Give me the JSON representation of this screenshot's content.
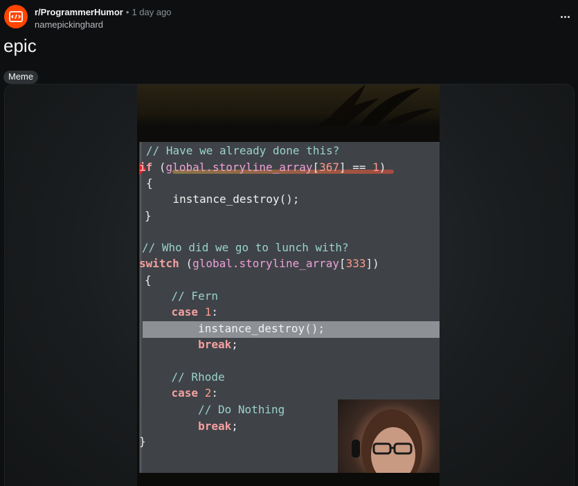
{
  "post": {
    "subreddit": "r/ProgrammerHumor",
    "separator": "•",
    "time": "1 day ago",
    "author": "namepickinghard",
    "title": "epic",
    "flair": "Meme"
  },
  "icons": {
    "subreddit_avatar": "subreddit-logo-icon",
    "more": "more-options-icon"
  },
  "colors": {
    "background": "#0e0f11",
    "avatar": "#ff4500",
    "flair_bg": "#2e3235"
  },
  "media": {
    "code_lines": [
      {
        "parts": [
          {
            "t": "// Have we already done this?",
            "c": "c-comment"
          }
        ]
      },
      {
        "parts": [
          {
            "t": "if ",
            "c": "c-kw"
          },
          {
            "t": "(",
            "c": "c-plain"
          },
          {
            "t": "global",
            "c": "c-glob"
          },
          {
            "t": ".storyline_array",
            "c": "c-glob"
          },
          {
            "t": "[",
            "c": "c-plain"
          },
          {
            "t": "367",
            "c": "c-num"
          },
          {
            "t": "] == ",
            "c": "c-plain"
          },
          {
            "t": "1",
            "c": "c-num"
          },
          {
            "t": ")",
            "c": "c-plain"
          }
        ]
      },
      {
        "parts": [
          {
            "t": "{",
            "c": "c-plain"
          }
        ]
      },
      {
        "parts": [
          {
            "t": "    instance_destroy",
            "c": "c-fn"
          },
          {
            "t": "();",
            "c": "c-plain"
          }
        ]
      },
      {
        "parts": [
          {
            "t": "}",
            "c": "c-plain"
          }
        ]
      },
      {
        "parts": [
          {
            "t": "",
            "c": "c-plain"
          }
        ]
      },
      {
        "parts": [
          {
            "t": "// Who did we go to lunch with?",
            "c": "c-comment"
          }
        ]
      },
      {
        "parts": [
          {
            "t": "switch ",
            "c": "c-kw"
          },
          {
            "t": "(",
            "c": "c-plain"
          },
          {
            "t": "global",
            "c": "c-glob"
          },
          {
            "t": ".storyline_array",
            "c": "c-glob"
          },
          {
            "t": "[",
            "c": "c-plain"
          },
          {
            "t": "333",
            "c": "c-num"
          },
          {
            "t": "])",
            "c": "c-plain"
          }
        ]
      },
      {
        "parts": [
          {
            "t": "{",
            "c": "c-plain"
          }
        ]
      },
      {
        "parts": [
          {
            "t": "    // Fern",
            "c": "c-comment"
          }
        ]
      },
      {
        "parts": [
          {
            "t": "    case ",
            "c": "c-kw"
          },
          {
            "t": "1",
            "c": "c-num"
          },
          {
            "t": ":",
            "c": "c-plain"
          }
        ]
      },
      {
        "parts": [
          {
            "t": "        instance_destroy",
            "c": "c-fn"
          },
          {
            "t": "();",
            "c": "c-plain"
          }
        ]
      },
      {
        "parts": [
          {
            "t": "        break",
            "c": "c-kw"
          },
          {
            "t": ";",
            "c": "c-plain"
          }
        ]
      },
      {
        "parts": [
          {
            "t": "",
            "c": "c-plain"
          }
        ]
      },
      {
        "parts": [
          {
            "t": "    // Rhode",
            "c": "c-comment"
          }
        ]
      },
      {
        "parts": [
          {
            "t": "    case ",
            "c": "c-kw"
          },
          {
            "t": "2",
            "c": "c-num"
          },
          {
            "t": ":",
            "c": "c-plain"
          }
        ]
      },
      {
        "parts": [
          {
            "t": "        // Do Nothing",
            "c": "c-comment"
          }
        ]
      },
      {
        "parts": [
          {
            "t": "        break",
            "c": "c-kw"
          },
          {
            "t": ";",
            "c": "c-plain"
          }
        ]
      },
      {
        "parts": [
          {
            "t": "}",
            "c": "c-plain"
          }
        ]
      }
    ]
  }
}
